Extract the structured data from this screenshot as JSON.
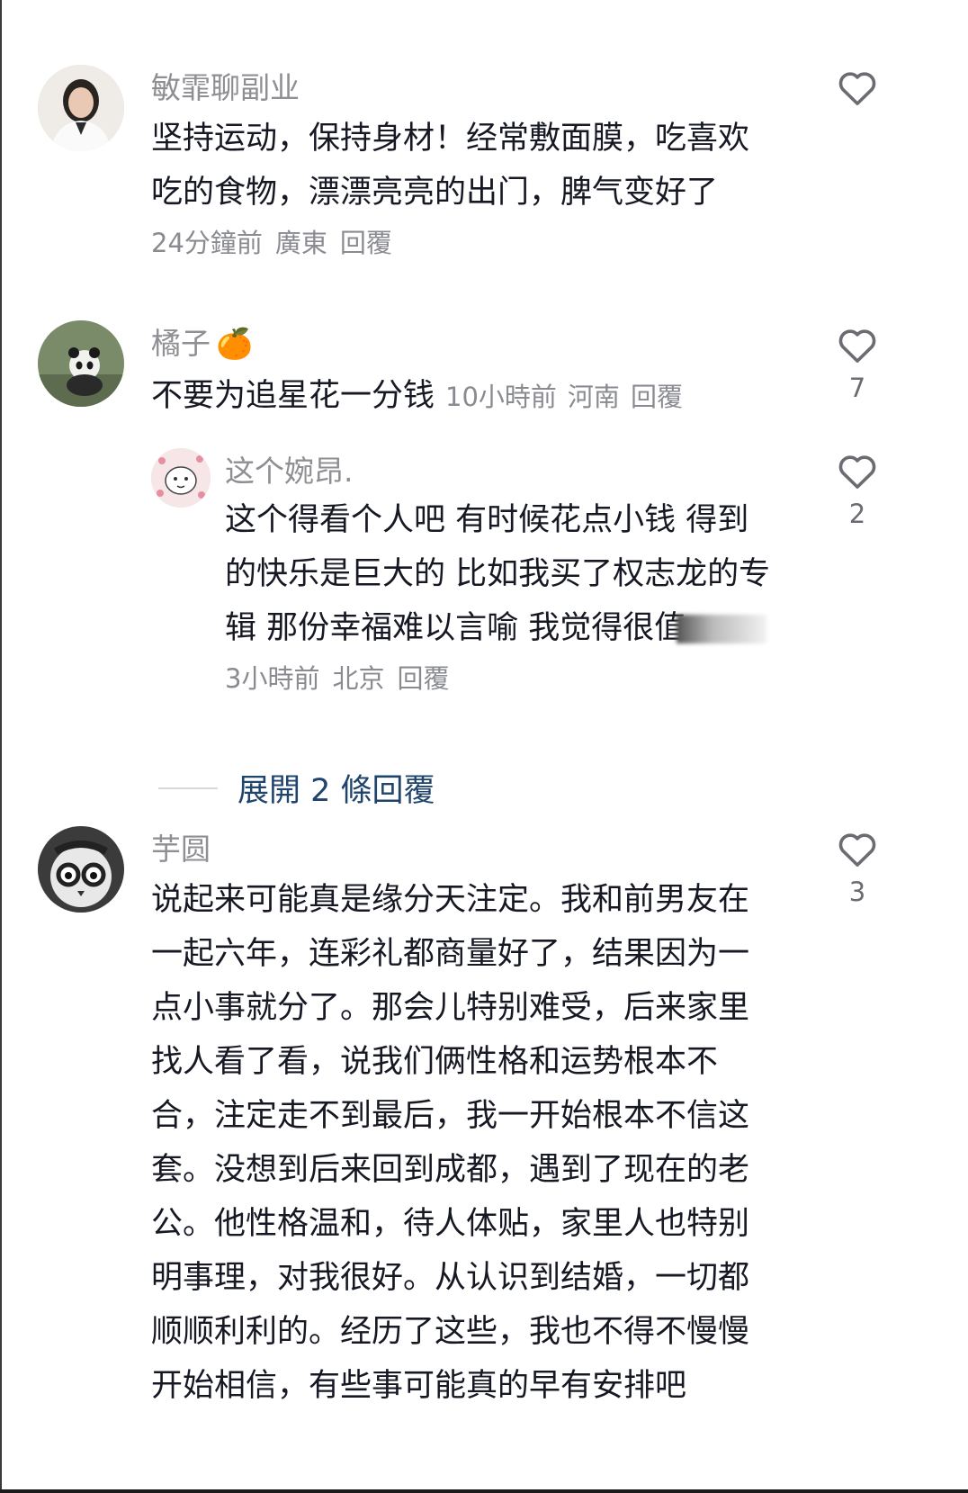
{
  "comments": [
    {
      "username": "敏霏聊副业",
      "lines": [
        "坚持运动，保持身材！经常敷面膜，吃喜欢",
        "吃的食物，漂漂亮亮的出门，脾气变好了"
      ],
      "time": "24分鐘前",
      "location": "廣東",
      "reply_label": "回覆",
      "likes": ""
    },
    {
      "username": "橘子",
      "username_emoji": "🍊",
      "lines": [
        "不要为追星花一分钱"
      ],
      "time": "10小時前",
      "location": "河南",
      "reply_label": "回覆",
      "likes": "7",
      "reply": {
        "username": "这个婉昂.",
        "lines": [
          "这个得看个人吧 有时候花点小钱 得到",
          "的快乐是巨大的 比如我买了权志龙的专",
          "辑 那份幸福难以言喻 我觉得很值"
        ],
        "time": "3小時前",
        "location": "北京",
        "reply_label": "回覆",
        "likes": "2"
      },
      "expand_label": "展開 2 條回覆"
    },
    {
      "username": "芋圆",
      "lines": [
        "说起来可能真是缘分天注定。我和前男友在",
        "一起六年，连彩礼都商量好了，结果因为一",
        "点小事就分了。那会儿特别难受，后来家里",
        "找人看了看，说我们俩性格和运势根本不",
        "合，注定走不到最后，我一开始根本不信这",
        "套。没想到后来回到成都，遇到了现在的老",
        "公。他性格温和，待人体贴，家里人也特别",
        "明事理，对我很好。从认识到结婚，一切都",
        "顺顺利利的。经历了这些，我也不得不慢慢",
        "开始相信，有些事可能真的早有安排吧"
      ],
      "likes": "3"
    }
  ],
  "icons": {
    "like": "heart-outline-icon"
  },
  "colors": {
    "username": "#8e8e93",
    "text": "#161823",
    "meta": "#8a8b91",
    "expand": "#20456d"
  }
}
